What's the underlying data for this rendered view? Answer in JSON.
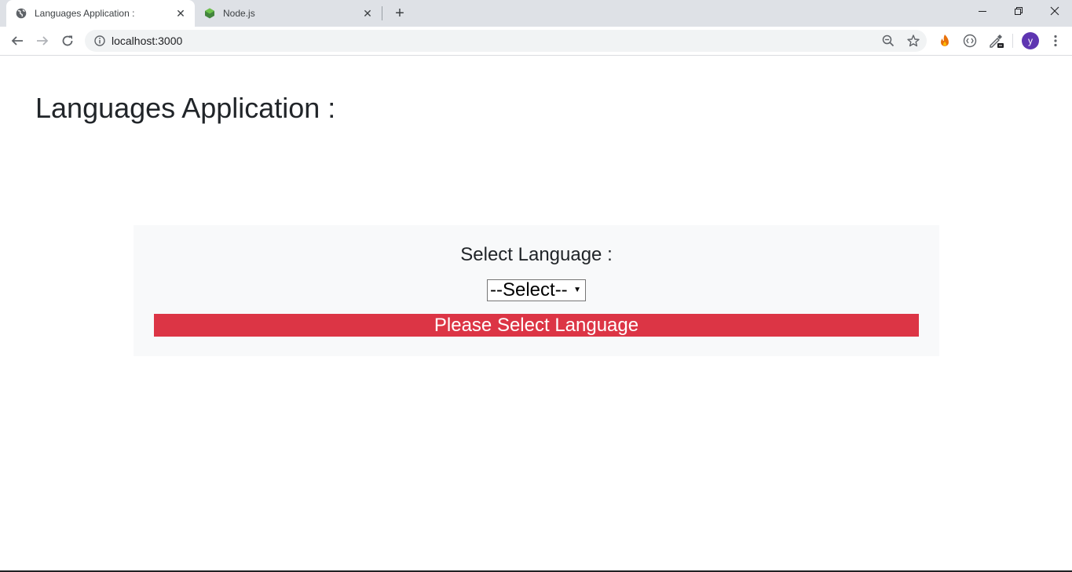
{
  "browser": {
    "tabs": [
      {
        "title": "Languages Application :",
        "active": true,
        "favicon": "globe-icon"
      },
      {
        "title": "Node.js",
        "active": false,
        "favicon": "nodejs-hexagon-icon"
      }
    ],
    "new_tab_label": "+",
    "window_controls": {
      "minimize": "—",
      "restore": "❐",
      "close": "✕"
    },
    "address_bar": {
      "url": "localhost:3000"
    },
    "profile_initial": "y",
    "colors": {
      "avatar": "#5e35b1",
      "node_green": "#43853d"
    }
  },
  "page": {
    "title": "Languages Application :",
    "form": {
      "label": "Select Language :",
      "select_value": "--Select--",
      "alert_text": "Please Select Language"
    },
    "colors": {
      "alert": "#dc3545",
      "panel": "#f8f9fa"
    }
  }
}
